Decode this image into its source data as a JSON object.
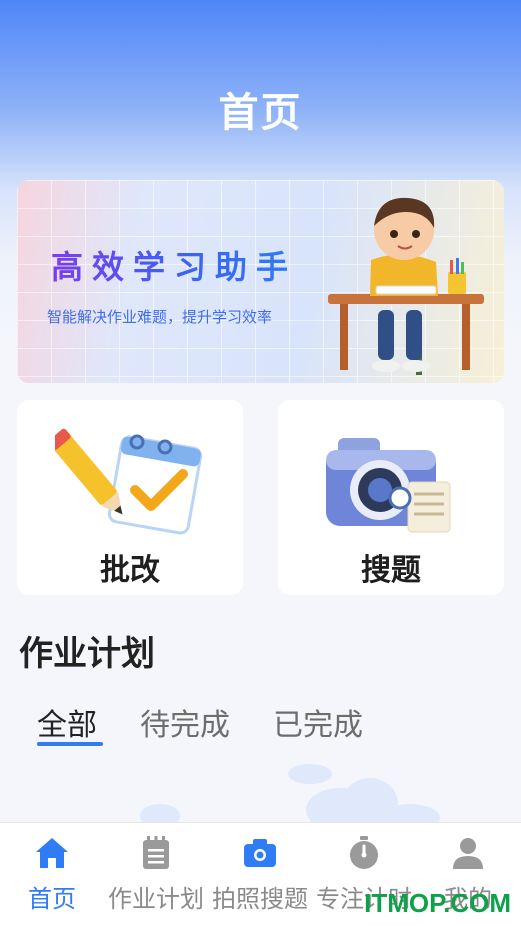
{
  "header": {
    "title": "首页"
  },
  "banner": {
    "title": "高效学习助手",
    "subtitle": "智能解决作业难题，提升学习效率"
  },
  "features": [
    {
      "label": "批改",
      "icon": "calendar-pencil-icon"
    },
    {
      "label": "搜题",
      "icon": "camera-search-icon"
    }
  ],
  "section": {
    "title": "作业计划"
  },
  "tabs": [
    {
      "label": "全部",
      "active": true
    },
    {
      "label": "待完成",
      "active": false
    },
    {
      "label": "已完成",
      "active": false
    }
  ],
  "bottom_nav": [
    {
      "label": "首页",
      "icon": "home-icon",
      "active": true
    },
    {
      "label": "作业计划",
      "icon": "notepad-icon",
      "active": false
    },
    {
      "label": "拍照搜题",
      "icon": "camera-icon",
      "active": false
    },
    {
      "label": "专注计时",
      "icon": "stopwatch-icon",
      "active": false
    },
    {
      "label": "我的",
      "icon": "user-icon",
      "active": false
    }
  ],
  "watermark": "ITMOP.COM",
  "colors": {
    "accent": "#2f7cf5",
    "header_top": "#4f86f7",
    "watermark": "#0ea14a"
  }
}
